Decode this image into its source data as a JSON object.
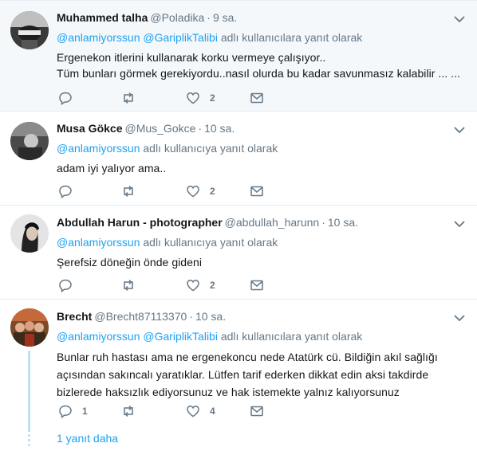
{
  "tweets": [
    {
      "name": "Muhammed talha",
      "handle": "@Poladika",
      "time": "9 sa.",
      "reply_mentions": [
        "@anlamiyorssun",
        "@GariplikTalibi"
      ],
      "reply_suffix": "adlı kullanıcılara yanıt olarak",
      "text_lines": [
        "Ergenekon itlerini kullanarak korku vermeye çalışıyor..",
        "Tüm bunları görmek gerekiyordu..nasıl olurda bu kadar savunmasız kalabilir ... ..."
      ],
      "reply_count": "",
      "retweet_count": "",
      "like_count": "2"
    },
    {
      "name": "Musa Gökce",
      "handle": "@Mus_Gokce",
      "time": "10 sa.",
      "reply_mentions": [
        "@anlamiyorssun"
      ],
      "reply_suffix": "adlı kullanıcıya yanıt olarak",
      "text_lines": [
        "adam iyi yalıyor ama.."
      ],
      "reply_count": "",
      "retweet_count": "",
      "like_count": "2"
    },
    {
      "name": "Abdullah Harun - photographer",
      "handle": "@abdullah_harunn",
      "time": "10 sa.",
      "reply_mentions": [
        "@anlamiyorssun"
      ],
      "reply_suffix": "adlı kullanıcıya yanıt olarak",
      "text_lines": [
        "Şerefsiz döneğin önde gideni"
      ],
      "reply_count": "",
      "retweet_count": "",
      "like_count": "2"
    },
    {
      "name": "Brecht",
      "handle": "@Brecht87113370",
      "time": "10 sa.",
      "reply_mentions": [
        "@anlamiyorssun",
        "@GariplikTalibi"
      ],
      "reply_suffix": "adlı kullanıcılara yanıt olarak",
      "text_lines": [
        "Bunlar ruh hastası ama ne ergenekoncu nede Atatürk cü. Bildiğin akıl sağlığı",
        "açısından sakıncalı yaratıklar. Lütfen tarif ederken dikkat edin aksi takdirde",
        "bizlerede haksızlık ediyorsunuz ve hak istemekte yalnız kalıyorsunuz"
      ],
      "reply_count": "1",
      "retweet_count": "",
      "like_count": "4"
    }
  ],
  "show_more_replies": "1 yanıt daha",
  "colors": {
    "accent": "#1da1f2",
    "muted": "#657786",
    "text": "#14171a",
    "highlight_bg": "#f5f8fa",
    "thread_line": "#c2e0f4"
  },
  "icons": {
    "reply": "reply-icon",
    "retweet": "retweet-icon",
    "like": "heart-icon",
    "dm": "envelope-icon",
    "menu": "chevron-down-icon"
  }
}
